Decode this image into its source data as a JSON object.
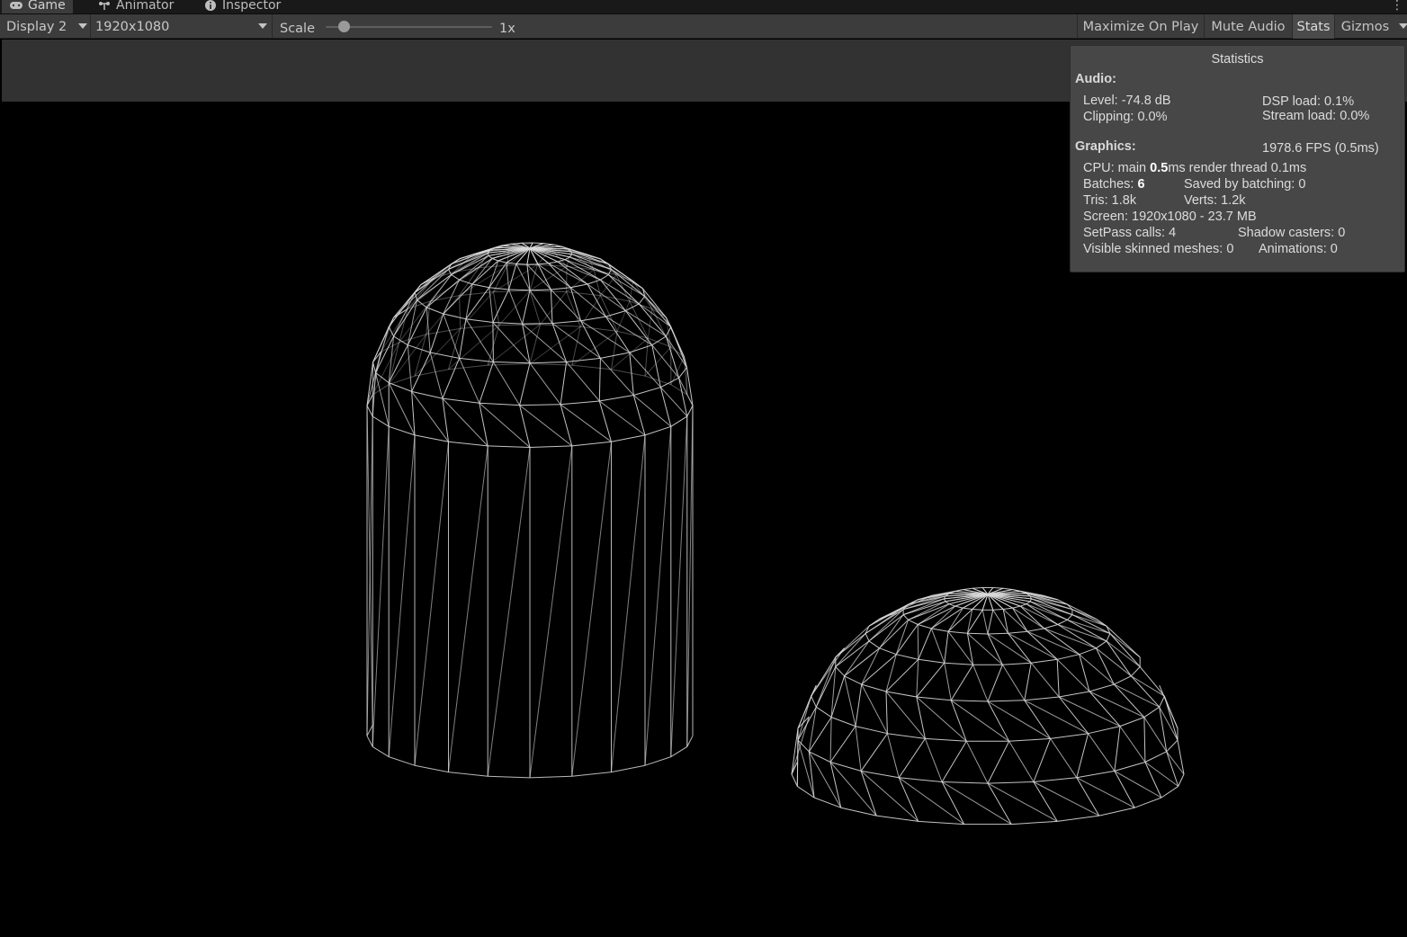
{
  "tabs": [
    {
      "label": "Game",
      "icon": "gamepad-icon",
      "active": true
    },
    {
      "label": "Animator",
      "icon": "animator-icon",
      "active": false
    },
    {
      "label": "Inspector",
      "icon": "info-icon",
      "active": false
    }
  ],
  "toolbar": {
    "display": "Display 2",
    "resolution": "1920x1080",
    "scale_label": "Scale",
    "scale_value": "1x",
    "scale_slider_fraction": 0.1,
    "maximize": "Maximize On Play",
    "mute": "Mute Audio",
    "stats": "Stats",
    "gizmos": "Gizmos"
  },
  "stats": {
    "title": "Statistics",
    "audio_header": "Audio:",
    "level": "Level: -74.8 dB",
    "dsp": "DSP load: 0.1%",
    "clipping": "Clipping: 0.0%",
    "stream": "Stream load: 0.0%",
    "graphics_header": "Graphics:",
    "fps": "1978.6 FPS (0.5ms)",
    "cpu_prefix": "CPU: main ",
    "cpu_main": "0.5",
    "cpu_suffix": "ms  render thread 0.1ms",
    "batches_prefix": "Batches: ",
    "batches": "6",
    "saved": "Saved by batching: 0",
    "tris": "Tris: 1.8k",
    "verts": "Verts: 1.2k",
    "screen": "Screen: 1920x1080 - 23.7 MB",
    "setpass": "SetPass calls: 4",
    "shadow": "Shadow casters: 0",
    "skinned": "Visible skinned meshes: 0",
    "animations": "Animations: 0"
  },
  "colors": {
    "toolbar_bg": "#3c3c3c",
    "panel_bg": "#474747",
    "wire": "#d9d9d9",
    "viewport_bg": "#000000"
  }
}
